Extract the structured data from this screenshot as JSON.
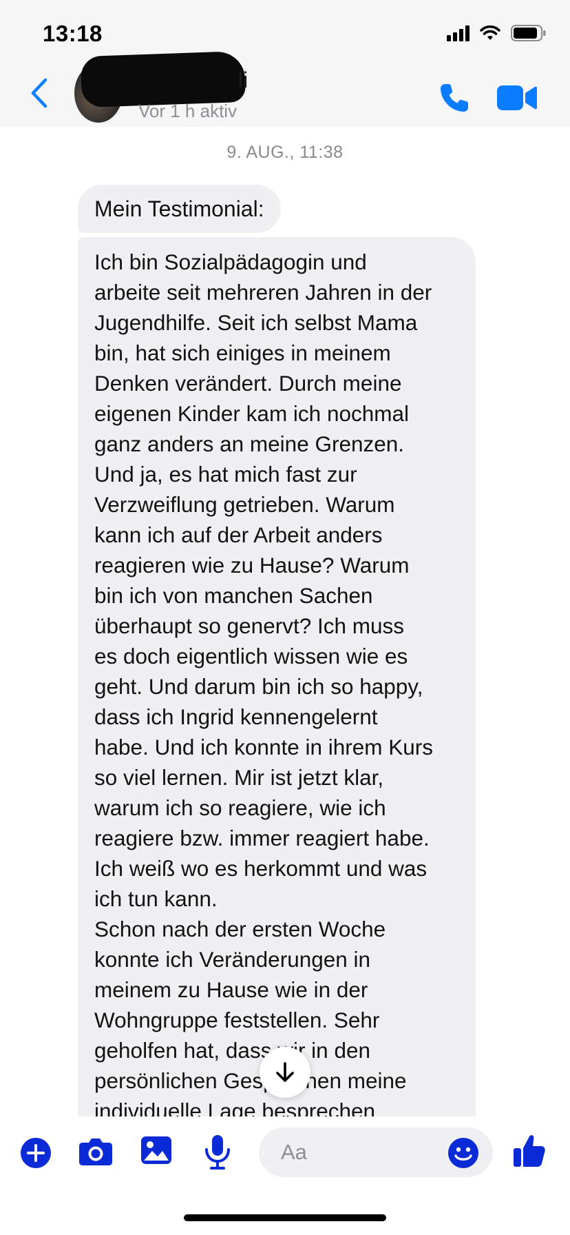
{
  "status_bar": {
    "time": "13:18",
    "icons": [
      "signal-icon",
      "wifi-icon",
      "battery-icon"
    ]
  },
  "header": {
    "back_icon": "chevron-left-icon",
    "contact_name_visible": "li",
    "contact_status": "Vor 1 h aktiv",
    "actions": [
      "phone-icon",
      "video-camera-icon"
    ]
  },
  "chat": {
    "timestamp": "9. AUG., 11:38",
    "messages": [
      {
        "text": "Mein Testimonial:"
      },
      {
        "text": "Ich bin Sozialpädagogin und\narbeite seit mehreren Jahren in der\nJugendhilfe. Seit ich selbst Mama\nbin, hat sich einiges in meinem\nDenken verändert. Durch meine\neigenen Kinder kam ich nochmal\nganz anders an meine Grenzen.\nUnd ja, es hat mich fast zur\nVerzweiflung getrieben. Warum\nkann ich auf der Arbeit anders\nreagieren wie zu Hause? Warum\nbin ich von manchen Sachen\nüberhaupt so genervt? Ich muss\nes doch eigentlich wissen wie es\ngeht. Und darum bin ich so happy,\ndass ich Ingrid kennengelernt\nhabe. Und ich konnte in ihrem Kurs\nso viel lernen. Mir ist jetzt klar,\nwarum ich so reagiere, wie ich\nreagiere bzw. immer reagiert habe.\nIch weiß wo es herkommt und was\nich tun kann.\nSchon nach der ersten Woche\nkonnte ich Veränderungen in\nmeinem zu Hause wie in der\nWohngruppe feststellen. Sehr\ngeholfen hat, dass wir in den\npersönlichen Gesprächen meine\nindividuelle Lage besprechen"
      }
    ],
    "scroll_button_icon": "arrow-down-icon"
  },
  "composer": {
    "icons": [
      "plus-icon",
      "camera-icon",
      "image-icon",
      "microphone-icon"
    ],
    "input_placeholder": "Aa",
    "emoji_icon": "smiley-icon",
    "like_icon": "thumbs-up-icon"
  },
  "colors": {
    "accent": "#0a7cff",
    "composer_icon": "#0b2bd6",
    "bubble": "#f0f0f3",
    "status_gray": "#8e8e93"
  }
}
